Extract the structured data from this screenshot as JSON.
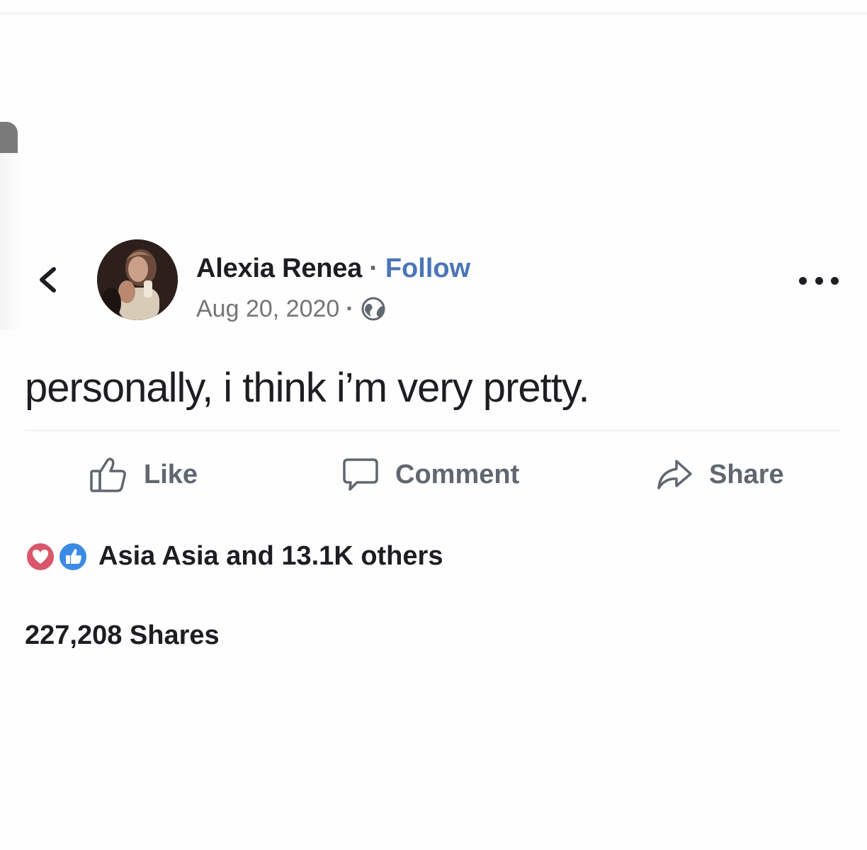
{
  "post": {
    "author": "Alexia Renea",
    "separator": "·",
    "follow_label": "Follow",
    "date": "Aug 20, 2020",
    "meta_separator": "·",
    "privacy_icon": "globe-icon",
    "text": "personally, i think i’m very pretty."
  },
  "actions": {
    "like_label": "Like",
    "comment_label": "Comment",
    "share_label": "Share"
  },
  "reactions": {
    "icons": [
      "heart-reaction-icon",
      "like-reaction-icon"
    ],
    "summary": "Asia Asia and 13.1K others"
  },
  "shares": {
    "label": "227,208 Shares"
  },
  "colors": {
    "follow_link": "#4a76b8",
    "heart_reaction": "#d9576b",
    "like_reaction": "#3b8ae6",
    "muted_text": "#606770"
  }
}
